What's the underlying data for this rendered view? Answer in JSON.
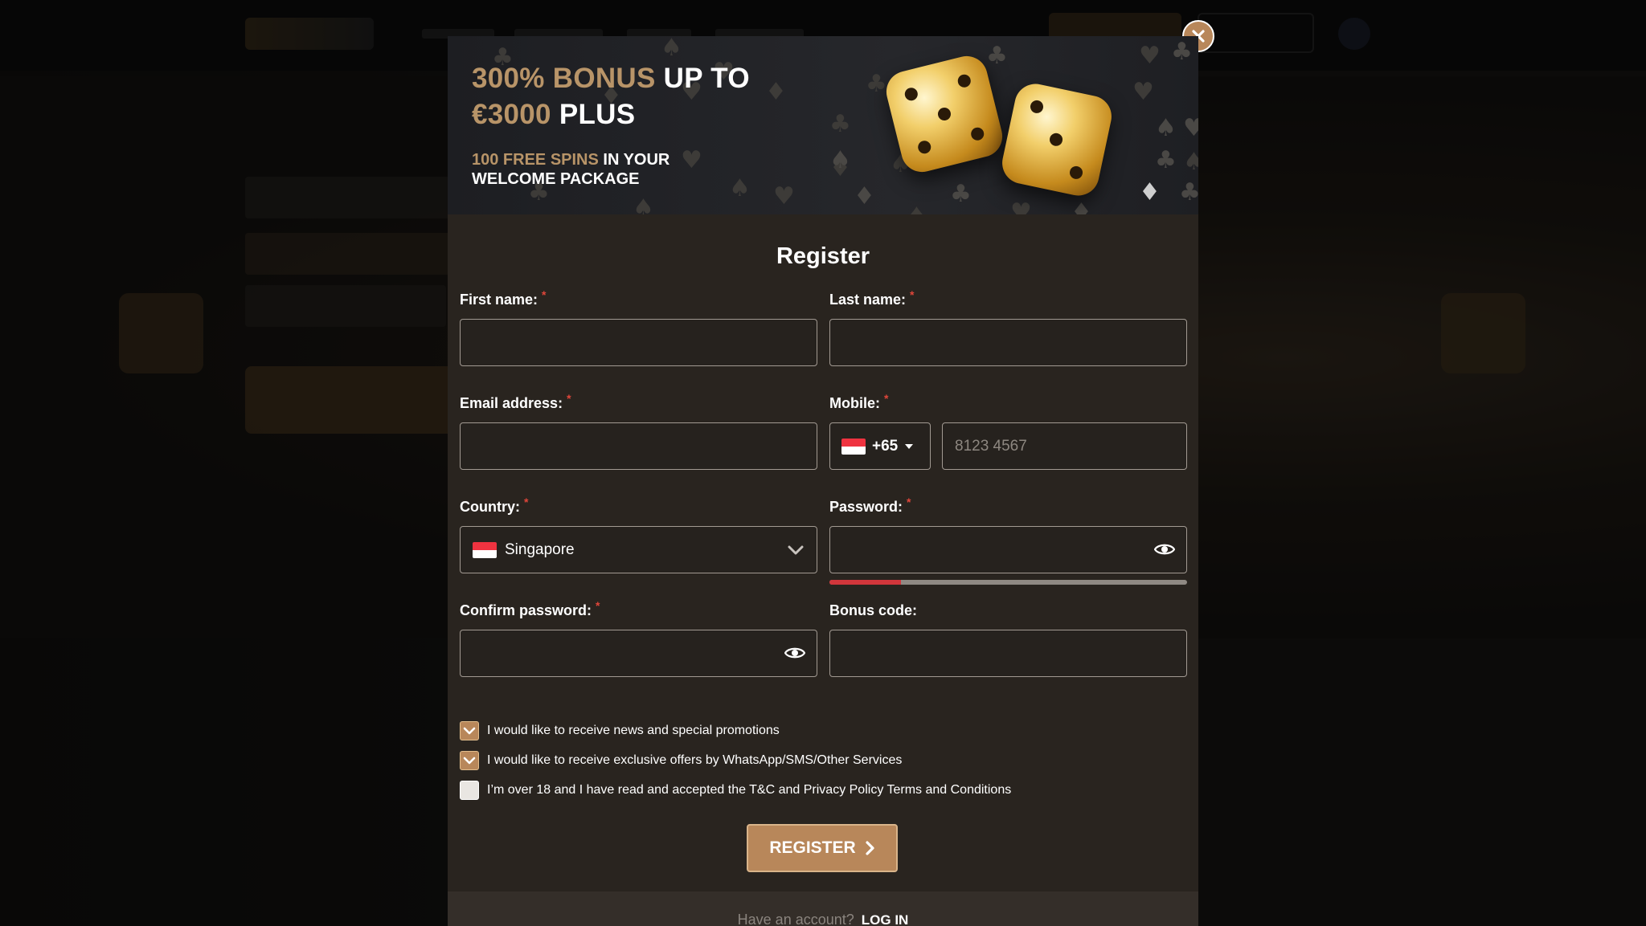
{
  "promo": {
    "line1_gold": "300% BONUS",
    "line1_white": " UP TO",
    "line2_gold": "€3000",
    "line2_white": " PLUS",
    "sub1_gold": "100 FREE SPINS",
    "sub1_white": " IN YOUR",
    "sub2": "WELCOME PACKAGE"
  },
  "form": {
    "title": "Register",
    "first_name_label": "First name:",
    "last_name_label": "Last name:",
    "email_label": "Email address:",
    "mobile_label": "Mobile:",
    "mobile_code": "+65",
    "mobile_placeholder": "8123 4567",
    "country_label": "Country:",
    "country_value": "Singapore",
    "password_label": "Password:",
    "password_strength": 0.2,
    "confirm_password_label": "Confirm password:",
    "bonus_code_label": "Bonus code:",
    "required_mark": "*"
  },
  "checkboxes": [
    {
      "label": "I would like to receive news and special promotions",
      "checked": true
    },
    {
      "label": "I would like to receive exclusive offers by WhatsApp/SMS/Other Services",
      "checked": true
    },
    {
      "label": "I’m over 18 and I have read and accepted the T&C and Privacy Policy Terms and Conditions",
      "checked": false
    }
  ],
  "register_button": "REGISTER",
  "footer": {
    "prompt": "Have an account?",
    "login": "LOG IN"
  },
  "colors": {
    "accent": "#b8875a",
    "strength_weak": "#d1363b"
  }
}
